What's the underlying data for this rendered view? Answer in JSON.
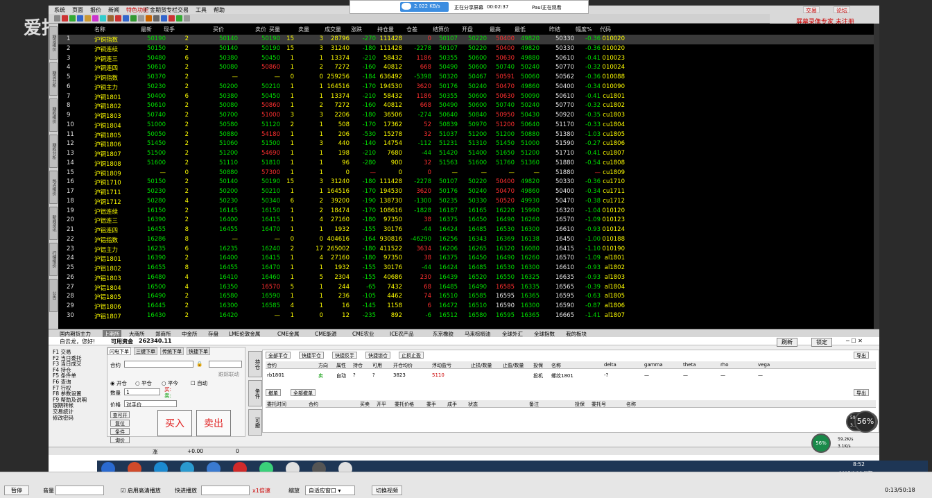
{
  "watermark": "爱拍",
  "menu": [
    "系统",
    "页面",
    "报价",
    "新闻",
    "特色功能",
    "广金期货专栏",
    "交易",
    "工具",
    "帮助"
  ],
  "top_right": {
    "trade": "交易",
    "forum": "论坛",
    "recorder": "屏幕录像专家 未注册"
  },
  "popup": {
    "speed": "2.022 KB/s",
    "share": "正在分享屏幕",
    "time": "00:02:37",
    "viewer": "Paul正在观看"
  },
  "side_tabs": [
    "期货报价",
    "期货分析",
    "期权报价",
    "期权分析",
    "热点报价",
    "新闻资讯",
    "行情报价",
    "公告"
  ],
  "grid_headers": [
    "名称",
    "最新",
    "现手",
    "买价",
    "卖价",
    "买量",
    "卖量",
    "成交量",
    "涨跌",
    "持仓量",
    "仓差",
    "结算价",
    "开盘",
    "最高",
    "最低",
    "昨结",
    "幅度%",
    "代码"
  ],
  "rows": [
    [
      "沪铜指数",
      "50190",
      "2",
      "50140",
      "50190",
      "15",
      "3",
      "28796",
      "-270",
      "111428",
      "0",
      "50107",
      "50220",
      "50400",
      "49820",
      "50330",
      "-0.36",
      "010020"
    ],
    [
      "沪铜连续",
      "50150",
      "2",
      "50140",
      "50190",
      "15",
      "3",
      "31240",
      "-180",
      "111428",
      "-2278",
      "50107",
      "50220",
      "50400",
      "49820",
      "50330",
      "-0.36",
      "010020"
    ],
    [
      "沪铜连三",
      "50480",
      "6",
      "50380",
      "50450",
      "1",
      "1",
      "13374",
      "-210",
      "58432",
      "1186",
      "50355",
      "50600",
      "50630",
      "49880",
      "50610",
      "-0.41",
      "010023"
    ],
    [
      "沪铜连四",
      "50610",
      "2",
      "50080",
      "50860",
      "1",
      "2",
      "7272",
      "-160",
      "40812",
      "668",
      "50490",
      "50600",
      "50740",
      "50240",
      "50770",
      "-0.32",
      "010024"
    ],
    [
      "沪铜指数",
      "50370",
      "2",
      "—",
      "—",
      "0",
      "0",
      "259256",
      "-184",
      "636492",
      "-5398",
      "50320",
      "50467",
      "50591",
      "50060",
      "50562",
      "-0.36",
      "010088"
    ],
    [
      "沪铜主力",
      "50230",
      "2",
      "50200",
      "50210",
      "1",
      "1",
      "164516",
      "-170",
      "194530",
      "3620",
      "50176",
      "50240",
      "50470",
      "49860",
      "50400",
      "-0.34",
      "010090"
    ],
    [
      "沪铜1801",
      "50400",
      "6",
      "50380",
      "50450",
      "1",
      "1",
      "13374",
      "-210",
      "58432",
      "1186",
      "50355",
      "50600",
      "50630",
      "50090",
      "50610",
      "-0.41",
      "cu1801"
    ],
    [
      "沪铜1802",
      "50610",
      "2",
      "50080",
      "50860",
      "1",
      "2",
      "7272",
      "-160",
      "40812",
      "668",
      "50490",
      "50600",
      "50740",
      "50240",
      "50770",
      "-0.32",
      "cu1802"
    ],
    [
      "沪铜1803",
      "50740",
      "2",
      "50700",
      "51000",
      "3",
      "3",
      "2206",
      "-180",
      "36506",
      "-274",
      "50640",
      "50840",
      "50950",
      "50430",
      "50920",
      "-0.35",
      "cu1803"
    ],
    [
      "沪铜1804",
      "51000",
      "2",
      "50580",
      "51120",
      "2",
      "1",
      "508",
      "-170",
      "17362",
      "52",
      "50839",
      "50970",
      "51200",
      "50640",
      "51170",
      "-0.33",
      "cu1804"
    ],
    [
      "沪铜1805",
      "50050",
      "2",
      "50880",
      "54180",
      "1",
      "1",
      "206",
      "-530",
      "15278",
      "32",
      "51037",
      "51200",
      "51200",
      "50880",
      "51380",
      "-1.03",
      "cu1805"
    ],
    [
      "沪铜1806",
      "51450",
      "2",
      "51060",
      "51500",
      "1",
      "3",
      "440",
      "-140",
      "14754",
      "-112",
      "51231",
      "51310",
      "51450",
      "51000",
      "51590",
      "-0.27",
      "cu1806"
    ],
    [
      "沪铜1807",
      "51500",
      "2",
      "51200",
      "54690",
      "1",
      "1",
      "198",
      "-210",
      "7680",
      "-44",
      "51420",
      "51400",
      "51650",
      "51200",
      "51710",
      "-0.41",
      "cu1807"
    ],
    [
      "沪铜1808",
      "51600",
      "2",
      "51110",
      "51810",
      "1",
      "1",
      "96",
      "-280",
      "900",
      "32",
      "51563",
      "51600",
      "51760",
      "51360",
      "51880",
      "-0.54",
      "cu1808"
    ],
    [
      "沪铜1809",
      "—",
      "0",
      "50880",
      "57300",
      "1",
      "1",
      "0",
      "—",
      "0",
      "0",
      "—",
      "—",
      "—",
      "—",
      "51880",
      "—",
      "cu1809"
    ],
    [
      "沪铜1710",
      "50150",
      "2",
      "50140",
      "50190",
      "15",
      "3",
      "31240",
      "-180",
      "111428",
      "-2278",
      "50107",
      "50220",
      "50400",
      "49820",
      "50330",
      "-0.36",
      "cu1710"
    ],
    [
      "沪铜1711",
      "50230",
      "2",
      "50200",
      "50210",
      "1",
      "1",
      "164516",
      "-170",
      "194530",
      "3620",
      "50176",
      "50240",
      "50470",
      "49860",
      "50400",
      "-0.34",
      "cu1711"
    ],
    [
      "沪铜1712",
      "50280",
      "4",
      "50230",
      "50340",
      "6",
      "2",
      "39200",
      "-190",
      "138730",
      "-1300",
      "50235",
      "50330",
      "50520",
      "49930",
      "50470",
      "-0.38",
      "cu1712"
    ],
    [
      "沪铝连续",
      "16150",
      "2",
      "16145",
      "16150",
      "1",
      "2",
      "18474",
      "-170",
      "108616",
      "-1828",
      "16187",
      "16165",
      "16220",
      "15990",
      "16320",
      "-1.04",
      "010120"
    ],
    [
      "沪铝连三",
      "16390",
      "2",
      "16400",
      "16415",
      "1",
      "4",
      "27160",
      "-180",
      "97350",
      "38",
      "16375",
      "16450",
      "16490",
      "16260",
      "16570",
      "-1.09",
      "010123"
    ],
    [
      "沪铝连四",
      "16455",
      "8",
      "16455",
      "16470",
      "1",
      "1",
      "1932",
      "-155",
      "30176",
      "-44",
      "16424",
      "16485",
      "16530",
      "16300",
      "16610",
      "-0.93",
      "010124"
    ],
    [
      "沪铝指数",
      "16286",
      "8",
      "—",
      "—",
      "0",
      "0",
      "404616",
      "-164",
      "930816",
      "-46290",
      "16256",
      "16343",
      "16369",
      "16138",
      "16450",
      "-1.00",
      "010188"
    ],
    [
      "沪铝主力",
      "16235",
      "6",
      "16235",
      "16240",
      "2",
      "17",
      "265002",
      "-180",
      "411522",
      "3634",
      "16206",
      "16265",
      "16320",
      "16080",
      "16415",
      "-1.10",
      "010190"
    ],
    [
      "沪铝1801",
      "16390",
      "2",
      "16400",
      "16415",
      "1",
      "4",
      "27160",
      "-180",
      "97350",
      "38",
      "16375",
      "16450",
      "16490",
      "16260",
      "16570",
      "-1.09",
      "al1801"
    ],
    [
      "沪铝1802",
      "16455",
      "8",
      "16455",
      "16470",
      "1",
      "1",
      "1932",
      "-155",
      "30176",
      "-44",
      "16424",
      "16485",
      "16530",
      "16300",
      "16610",
      "-0.93",
      "al1802"
    ],
    [
      "沪铝1803",
      "16480",
      "4",
      "16410",
      "16460",
      "1",
      "5",
      "2304",
      "-155",
      "40686",
      "230",
      "16439",
      "16520",
      "16550",
      "16325",
      "16635",
      "-0.93",
      "al1803"
    ],
    [
      "沪铝1804",
      "16500",
      "4",
      "16350",
      "16570",
      "5",
      "1",
      "244",
      "-65",
      "7432",
      "68",
      "16485",
      "16490",
      "16585",
      "16335",
      "16565",
      "-0.39",
      "al1804"
    ],
    [
      "沪铝1805",
      "16490",
      "2",
      "16580",
      "16590",
      "1",
      "1",
      "236",
      "-105",
      "4462",
      "74",
      "16510",
      "16585",
      "16595",
      "16365",
      "16595",
      "-0.63",
      "al1805"
    ],
    [
      "沪铝1806",
      "16445",
      "2",
      "16300",
      "16585",
      "4",
      "1",
      "16",
      "-145",
      "1158",
      "6",
      "16472",
      "16510",
      "16590",
      "16300",
      "16590",
      "-0.87",
      "al1806"
    ],
    [
      "沪铝1807",
      "16430",
      "2",
      "16420",
      "—",
      "1",
      "0",
      "12",
      "-235",
      "892",
      "-6",
      "16512",
      "16580",
      "16595",
      "16365",
      "16665",
      "-1.41",
      "al1807"
    ]
  ],
  "grid_tabs": [
    "国内期货主力",
    "上期所",
    "大商所",
    "郑商所",
    "中金所",
    "存盘",
    "LME伦敦金属",
    "CME金属",
    "CME能源",
    "CME农业",
    "ICE农产品",
    "东京橡胶",
    "马来棕榈油",
    "全球外汇",
    "全球指数",
    "我的板块"
  ],
  "trade": {
    "greeting": "白云龙，您好!",
    "avail_label": "可用资金",
    "avail": "262340.11",
    "refresh": "刷新",
    "lock": "锁定",
    "tree": [
      "F1 交易",
      "F2 当日委托",
      "F3 当日成交",
      "F4 持仓",
      "F5 条件单",
      "F6 查询",
      "F7 行权",
      "F8 参数设置",
      "F9 帮助及说明",
      "银期转帐",
      "交易统计",
      "修改密码"
    ],
    "order_tabs": [
      "闪电下单",
      "三键下单",
      "传统下单",
      "快捷下单"
    ],
    "contract_label": "合约",
    "open": "开仓",
    "close": "平仓",
    "closetoday": "平今",
    "auto": "自动",
    "qty_label": "数量",
    "qty": "1",
    "price_label": "价格",
    "price": "对手价",
    "buy_hint": "买:",
    "sell_hint": "卖:",
    "small_btns": [
      "查可开",
      "复位",
      "条件",
      "询价"
    ],
    "buy": "买入",
    "sell": "卖出",
    "follow": "跟踪联动",
    "vtabs": [
      "持仓",
      "条件",
      "可撤"
    ],
    "pos_btns": [
      "全部平仓",
      "快捷平仓",
      "快捷反手",
      "快捷锁仓",
      "止损止盈"
    ],
    "export": "导出",
    "pos_headers": [
      "合约",
      "方向",
      "属性",
      "持仓",
      "可用",
      "开仓均价",
      "浮动盈亏",
      "止损/数量",
      "止盈/数量",
      "投保",
      "名称",
      "delta",
      "gamma",
      "theta",
      "rho",
      "vega"
    ],
    "pos_row": [
      "rb1801",
      "卖",
      "自动",
      "?",
      "?",
      "3823",
      "5110",
      "",
      "",
      "投机",
      "螺纹1801",
      "-?",
      "—",
      "—",
      "—",
      "—"
    ],
    "ord_btns": [
      "撤单",
      "全部撤单"
    ],
    "ord_headers": [
      "委托时间",
      "合约",
      "买卖",
      "开平",
      "委托价格",
      "委手",
      "成手",
      "状态",
      "备注",
      "投保",
      "委托号",
      "名称"
    ],
    "status": [
      "涨",
      "+0.00",
      "0"
    ]
  },
  "gauges": {
    "g1": "56%",
    "g1a": "59%",
    "g1b": "3.1%",
    "g2": "56%",
    "g2a": "59.2K/s",
    "g2b": "3.1K/s"
  },
  "taskbar": {
    "time": "8:52",
    "date": "2017/9/18 星期一"
  },
  "player": {
    "pause": "暂停",
    "volume": "音量",
    "hd": "启用高清播放",
    "fast": "快进播放",
    "speed": "x1倍速",
    "zoom": "缩放",
    "zoom_val": "自适应窗口",
    "switch": "切换视频",
    "time": "0:13/50:18"
  }
}
